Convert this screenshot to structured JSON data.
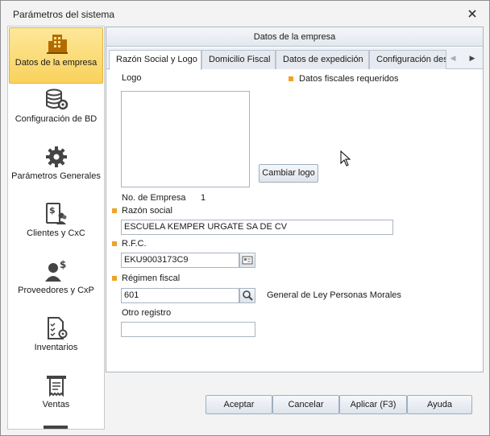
{
  "window": {
    "title": "Parámetros del sistema"
  },
  "sidebar": {
    "items": [
      {
        "label": "Datos de la empresa",
        "icon": "building-icon",
        "active": true
      },
      {
        "label": "Configuración de BD",
        "icon": "database-gear-icon"
      },
      {
        "label": "Parámetros Generales",
        "icon": "gear-icon"
      },
      {
        "label": "Clientes y CxC",
        "icon": "clients-money-icon"
      },
      {
        "label": "Proveedores y CxP",
        "icon": "supplier-money-icon"
      },
      {
        "label": "Inventarios",
        "icon": "inventory-checklist-icon"
      },
      {
        "label": "Ventas",
        "icon": "receipt-printer-icon"
      }
    ]
  },
  "main": {
    "header": "Datos de la empresa",
    "tabs": [
      {
        "label": "Razón Social y Logo",
        "active": true
      },
      {
        "label": "Domicilio Fiscal"
      },
      {
        "label": "Datos de expedición"
      },
      {
        "label": "Configuración des"
      }
    ],
    "form": {
      "logo_label": "Logo",
      "required_legend": "Datos fiscales requeridos",
      "change_logo_button": "Cambiar logo",
      "company_number_label": "No. de Empresa",
      "company_number_value": "1",
      "razon_social_label": "Razón social",
      "razon_social_value": "ESCUELA KEMPER URGATE SA DE CV",
      "rfc_label": "R.F.C.",
      "rfc_value": "EKU9003173C9",
      "regimen_label": "Régimen fiscal",
      "regimen_value": "601",
      "regimen_description": "General de Ley Personas Morales",
      "otro_registro_label": "Otro registro",
      "otro_registro_value": ""
    }
  },
  "footer": {
    "accept": "Aceptar",
    "cancel": "Cancelar",
    "apply": "Aplicar (F3)",
    "help": "Ayuda"
  },
  "colors": {
    "active_item": "#f9d25c",
    "required_marker": "#f0a326",
    "border": "#a9b5c3"
  }
}
